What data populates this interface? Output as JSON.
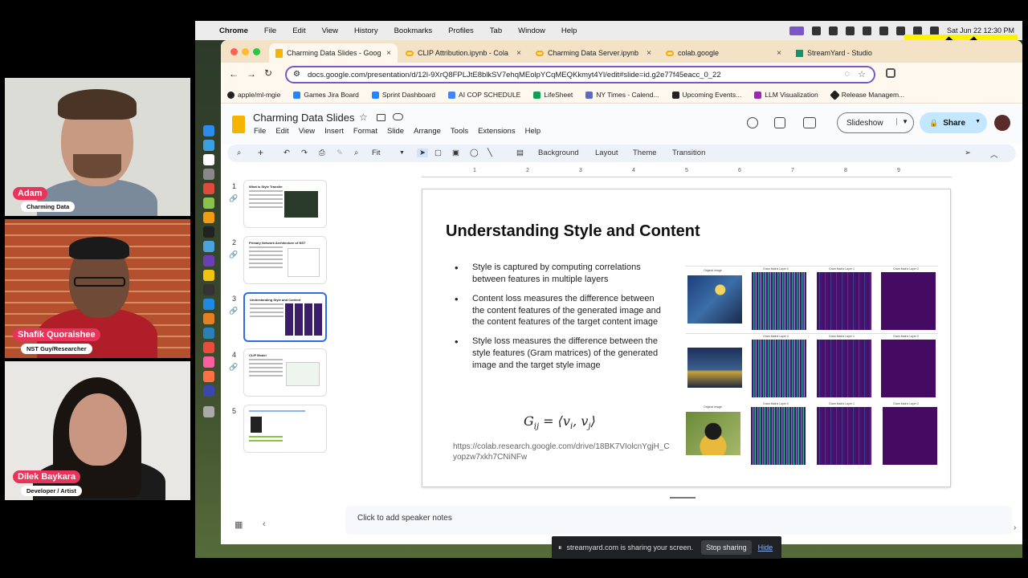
{
  "participants": [
    {
      "name": "Adam",
      "role": "Charming Data"
    },
    {
      "name": "Shafik Quoraishee",
      "role": "NST Guy/Researcher"
    },
    {
      "name": "Dilek Baykara",
      "role": "Developer / Artist"
    }
  ],
  "macmenu": {
    "items": [
      "Chrome",
      "File",
      "Edit",
      "View",
      "History",
      "Bookmarks",
      "Profiles",
      "Tab",
      "Window",
      "Help"
    ],
    "datetime": "Sat Jun 22  12:30 PM"
  },
  "tabs": [
    {
      "label": "Charming Data Slides - Goog",
      "active": true
    },
    {
      "label": "CLIP Attribution.ipynb - Cola",
      "active": false
    },
    {
      "label": "Charming Data Server.ipynb",
      "active": false
    },
    {
      "label": "colab.google",
      "active": false
    },
    {
      "label": "StreamYard - Studio",
      "active": false
    }
  ],
  "address": "docs.google.com/presentation/d/12l-9XrQ8FPLJtE8blkSV7ehqMEolpYCqMEQKkmyt4Yl/edit#slide=id.g2e77f45eacc_0_22",
  "bookmarks": [
    "apple/ml-mgie",
    "Games Jira Board",
    "Sprint Dashboard",
    "AI COP SCHEDULE",
    "LifeSheet",
    "NY Times - Calend...",
    "Upcoming Events...",
    "LLM Visualization",
    "Release Managem..."
  ],
  "app": {
    "title": "Charming Data Slides",
    "menu": [
      "File",
      "Edit",
      "View",
      "Insert",
      "Format",
      "Slide",
      "Arrange",
      "Tools",
      "Extensions",
      "Help"
    ],
    "slideshow": "Slideshow",
    "share": "Share"
  },
  "edit_toolbar": {
    "zoom": "Fit",
    "background": "Background",
    "layout": "Layout",
    "theme": "Theme",
    "transition": "Transition"
  },
  "ruler_marks": [
    "1",
    "2",
    "3",
    "4",
    "5",
    "6",
    "7",
    "8",
    "9"
  ],
  "slide_thumbs": [
    {
      "number": "1",
      "title": "What is Style Transfer"
    },
    {
      "number": "2",
      "title": "Primary Network Architecture of NST"
    },
    {
      "number": "3",
      "title": "Understanding Style and Content"
    },
    {
      "number": "4",
      "title": "CLIP Model"
    },
    {
      "number": "5",
      "title": ""
    }
  ],
  "slide": {
    "title": "Understanding Style and Content",
    "bullets": [
      "Style is captured by computing correlations between features in multiple layers",
      "Content loss measures the difference between the content features of the generated image and the content features of the target content image",
      "Style loss measures the difference between the style features (Gram matrices) of the generated image and the target style image"
    ],
    "formula_lhs": "G",
    "formula_sub": "ij",
    "formula_rhs": " = ⟨v",
    "formula_rhs2": ", v",
    "formula_end": "⟩",
    "formula_sub_i": "i",
    "formula_sub_j": "j",
    "url": "https://colab.research.google.com/drive/18BK7VIolcnYgjH_Cyopzw7xkh7CNiNFw",
    "grid_labels": [
      "Original Image",
      "Gram Matrix Layer 0",
      "Gram Matrix Layer 1",
      "Gram Matrix Layer 2"
    ]
  },
  "speaker_notes": "Click to add speaker notes",
  "share_bar": {
    "message": "streamyard.com is sharing your screen.",
    "stop": "Stop sharing",
    "hide": "Hide"
  },
  "colors": {
    "accent": "#e8335a",
    "logo": "#fff200",
    "selection": "#2c6bed"
  }
}
